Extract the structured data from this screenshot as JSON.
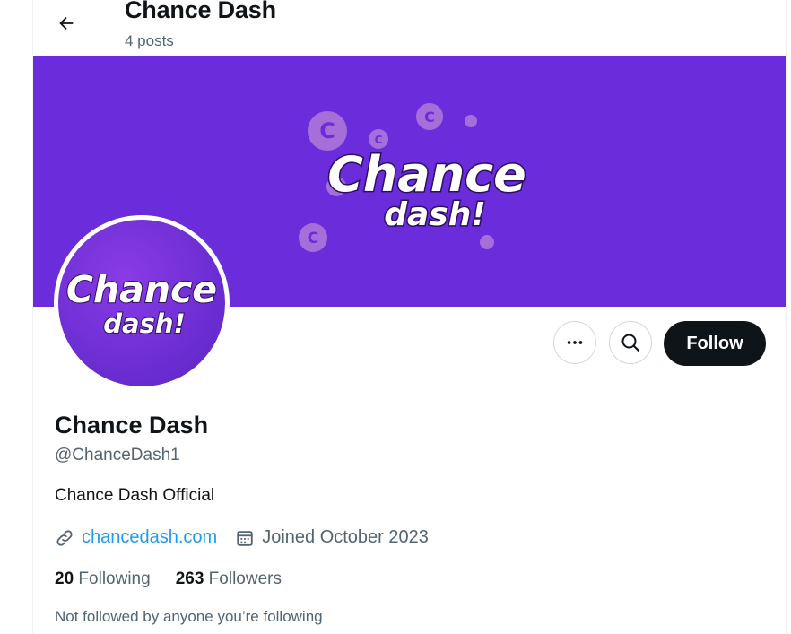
{
  "header": {
    "title": "Chance Dash",
    "post_count": "4 posts"
  },
  "banner": {
    "logo_line1": "Chance",
    "logo_line2": "dash!",
    "coin_letter": "C",
    "background_color": "#6b2cdb"
  },
  "avatar": {
    "logo_line1": "Chance",
    "logo_line2": "dash!"
  },
  "actions": {
    "more_icon": "more-horizontal-icon",
    "search_icon": "search-icon",
    "follow_label": "Follow"
  },
  "profile": {
    "name": "Chance Dash",
    "handle": "@ChanceDash1",
    "bio": "Chance Dash Official",
    "website": "chancedash.com",
    "joined": "Joined October 2023",
    "following_count": "20",
    "following_label": "Following",
    "followers_count": "263",
    "followers_label": "Followers",
    "not_followed_text": "Not followed by anyone you’re following"
  },
  "colors": {
    "accent": "#1d9bf0",
    "text": "#0f1419",
    "muted": "#536471",
    "follow_button": "#0f1419"
  }
}
